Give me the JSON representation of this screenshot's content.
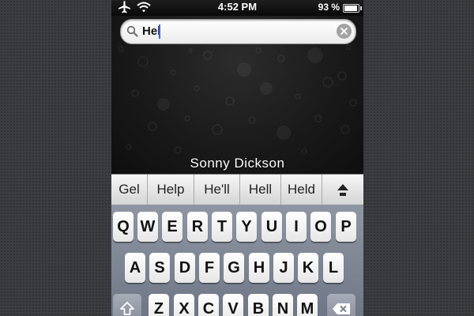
{
  "status_bar": {
    "time": "4:52 PM",
    "battery_percent": "93 %",
    "battery_level": 0.93,
    "icons": [
      "airplane-icon",
      "wifi-icon",
      "battery-icon"
    ]
  },
  "search": {
    "value": "Hel",
    "icons": [
      "search-icon",
      "clear-icon"
    ]
  },
  "caption": "Sonny Dickson",
  "suggestions": [
    "Gel",
    "Help",
    "He'll",
    "Hell",
    "Held"
  ],
  "suggestion_expand_icon": "chevron-up-icon",
  "keyboard": {
    "row1": [
      "Q",
      "W",
      "E",
      "R",
      "T",
      "Y",
      "U",
      "I",
      "O",
      "P"
    ],
    "row2": [
      "A",
      "S",
      "D",
      "F",
      "G",
      "H",
      "J",
      "K",
      "L"
    ],
    "row3": [
      "Z",
      "X",
      "C",
      "V",
      "B",
      "N",
      "M"
    ],
    "special_icons": [
      "shift-icon",
      "backspace-icon"
    ]
  },
  "colors": {
    "caret": "#3a62e0",
    "backdrop": "#3b3d40"
  }
}
